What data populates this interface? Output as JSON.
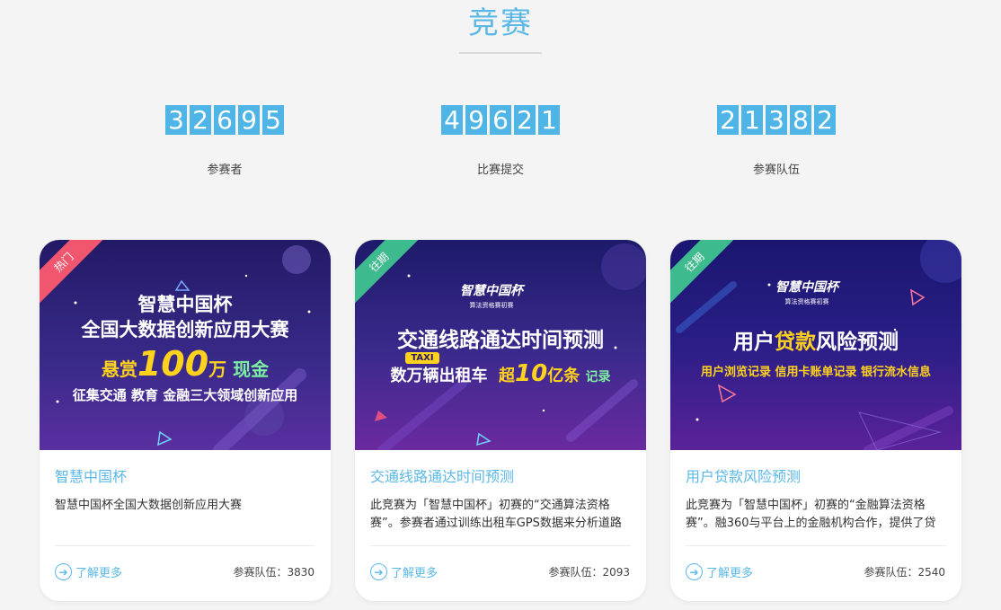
{
  "section": {
    "title": "竞赛"
  },
  "stats": [
    {
      "digits": [
        "3",
        "2",
        "6",
        "9",
        "5"
      ],
      "label": "参赛者"
    },
    {
      "digits": [
        "4",
        "9",
        "6",
        "2",
        "1"
      ],
      "label": "比赛提交"
    },
    {
      "digits": [
        "2",
        "1",
        "3",
        "8",
        "2"
      ],
      "label": "参赛队伍"
    }
  ],
  "cards": [
    {
      "ribbon": "热门",
      "banner": {
        "line1": "智慧中国杯",
        "line2": "全国大数据创新应用大赛",
        "prefix": "悬赏",
        "amount": "100",
        "unit": "万",
        "suffix": "现金",
        "line4": "征集交通 教育 金融三大领域创新应用"
      },
      "title": "智慧中国杯",
      "desc": "智慧中国杯全国大数据创新应用大赛",
      "more": "了解更多",
      "teams": "参赛队伍：3830"
    },
    {
      "ribbon": "往期",
      "banner": {
        "logo": "智慧中国杯",
        "logo_sub": "算法资格赛初赛",
        "headline": "交通线路通达时间预测",
        "taxi": "TAXI",
        "left": "数万辆出租车",
        "right_pre": "超",
        "right_num": "10",
        "right_unit": "亿条",
        "right_tail": "记录"
      },
      "title": "交通线路通达时间预测",
      "desc": "此竞赛为「智慧中国杯」初赛的“交通算法资格赛”。参赛者通过训练出租车GPS数据来分析道路交通状况，预测特殊时段的路线通达时间…",
      "more": "了解更多",
      "teams": "参赛队伍：2093"
    },
    {
      "ribbon": "往期",
      "banner": {
        "logo": "智慧中国杯",
        "logo_sub": "算法资格赛初赛",
        "headline_a": "用户",
        "headline_b": "贷款",
        "headline_c": "风险预测",
        "sub": "用户浏览记录 信用卡账单记录 银行流水信息"
      },
      "title": "用户贷款风险预测",
      "desc": "此竞赛为「智慧中国杯」初赛的“金融算法资格赛”。融360与平台上的金融机构合作，提供了贷款用户的基本身份信息、消费行为、银行流水等数据…",
      "more": "了解更多",
      "teams": "参赛队伍：2540"
    }
  ],
  "colors": {
    "accent": "#5bb8e6",
    "hot": "#f0566d",
    "past": "#3dbb8e",
    "gold": "#ffd21e"
  }
}
